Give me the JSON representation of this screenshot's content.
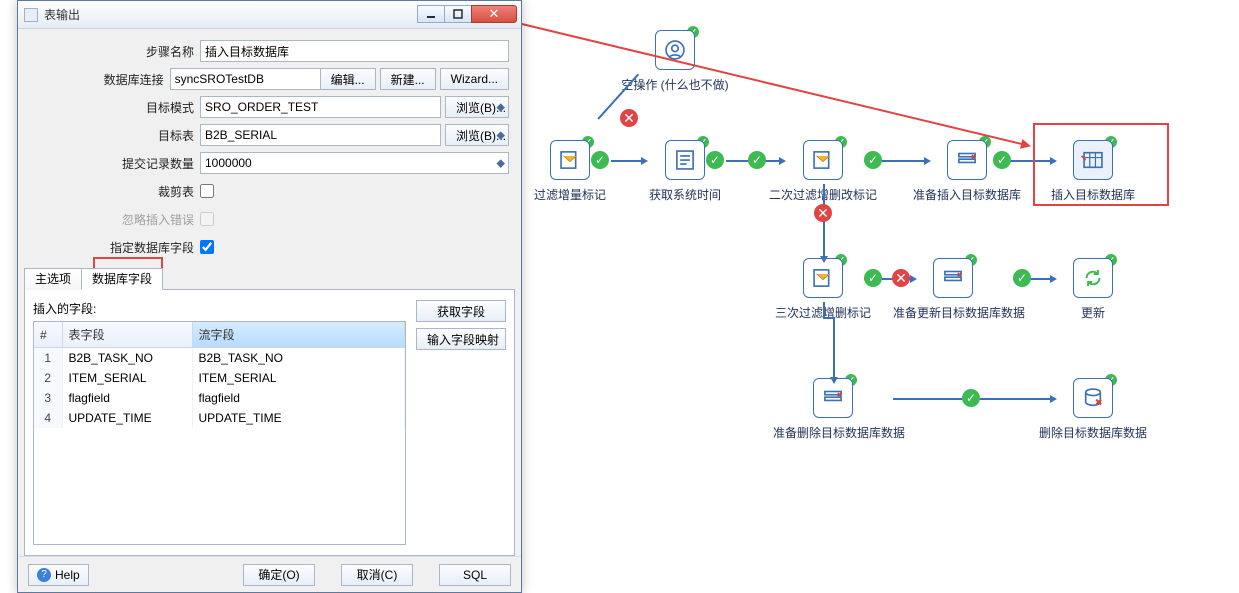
{
  "dialog": {
    "title": "表输出",
    "form": {
      "step_label": "步骤名称",
      "step_value": "插入目标数据库",
      "conn_label": "数据库连接",
      "conn_value": "syncSROTestDB",
      "conn_edit": "编辑...",
      "conn_new": "新建...",
      "conn_wizard": "Wizard...",
      "schema_label": "目标模式",
      "schema_value": "SRO_ORDER_TEST",
      "schema_browse": "浏览(B)...",
      "table_label": "目标表",
      "table_value": "B2B_SERIAL",
      "table_browse": "浏览(B)...",
      "commit_label": "提交记录数量",
      "commit_value": "1000000",
      "truncate_label": "裁剪表",
      "ignore_label": "忽略插入错误",
      "specify_label": "指定数据库字段"
    },
    "tabs": {
      "main": "主选项",
      "fields": "数据库字段"
    },
    "grid": {
      "caption": "插入的字段:",
      "col_num": "#",
      "col_table": "表字段",
      "col_stream": "流字段",
      "rows": [
        {
          "n": "1",
          "t": "B2B_TASK_NO",
          "s": "B2B_TASK_NO"
        },
        {
          "n": "2",
          "t": "ITEM_SERIAL",
          "s": "ITEM_SERIAL"
        },
        {
          "n": "3",
          "t": "flagfield",
          "s": "flagfield"
        },
        {
          "n": "4",
          "t": "UPDATE_TIME",
          "s": "UPDATE_TIME"
        }
      ],
      "btn_get": "获取字段",
      "btn_map": "输入字段映射"
    },
    "footer": {
      "help": "Help",
      "ok": "确定(O)",
      "cancel": "取消(C)",
      "sql": "SQL"
    }
  },
  "flow": {
    "n1": "空操作 (什么也不做)",
    "n2": "过滤增量标记",
    "n3": "获取系统时间",
    "n4": "二次过滤增删改标记",
    "n5": "准备插入目标数据库",
    "n6": "插入目标数据库",
    "n7": "三次过滤增删标记",
    "n8": "准备更新目标数据库数据",
    "n9": "更新",
    "n10": "准备删除目标数据库数据",
    "n11": "删除目标数据库数据"
  }
}
